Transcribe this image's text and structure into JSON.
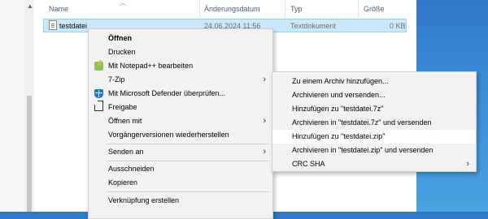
{
  "explorer": {
    "columns": {
      "name": "Name",
      "date": "Änderungsdatum",
      "type": "Typ",
      "size": "Größe"
    },
    "file": {
      "name": "testdatei",
      "date": "24.06.2024 11:56",
      "type": "Textdokument",
      "size": "0 KB"
    }
  },
  "context_menu": {
    "items": [
      {
        "label": "Öffnen",
        "bold": true
      },
      {
        "label": "Drucken"
      },
      {
        "label": "Mit Notepad++ bearbeiten",
        "icon": "notepadpp-icon"
      },
      {
        "label": "7-Zip",
        "submenu": true
      },
      {
        "label": "Mit Microsoft Defender überprüfen...",
        "icon": "defender-shield-icon"
      },
      {
        "label": "Freigabe",
        "icon": "share-icon"
      },
      {
        "label": "Öffnen mit",
        "submenu": true
      },
      {
        "label": "Vorgängerversionen wiederherstellen"
      },
      {
        "label": "Senden an",
        "submenu": true
      },
      {
        "label": "Ausschneiden"
      },
      {
        "label": "Kopieren"
      },
      {
        "label": "Verknüpfung erstellen"
      }
    ]
  },
  "zip_submenu": {
    "items": [
      {
        "label": "Zu einem Archiv hinzufügen..."
      },
      {
        "label": "Archivieren und versenden..."
      },
      {
        "label": "Hinzufügen zu \"testdatei.7z\""
      },
      {
        "label": "Archivieren in \"testdatei.7z\" und versenden"
      },
      {
        "label": "Hinzufügen zu \"testdatei.zip\"",
        "highlighted": true
      },
      {
        "label": "Archivieren in \"testdatei.zip\" und versenden"
      },
      {
        "label": "CRC SHA",
        "submenu": true
      }
    ]
  },
  "colors": {
    "selection": "#cce8ff",
    "menu_bg": "#f2f2f2",
    "menu_highlight": "#ffffff",
    "desktop": "#3c8ed8"
  }
}
